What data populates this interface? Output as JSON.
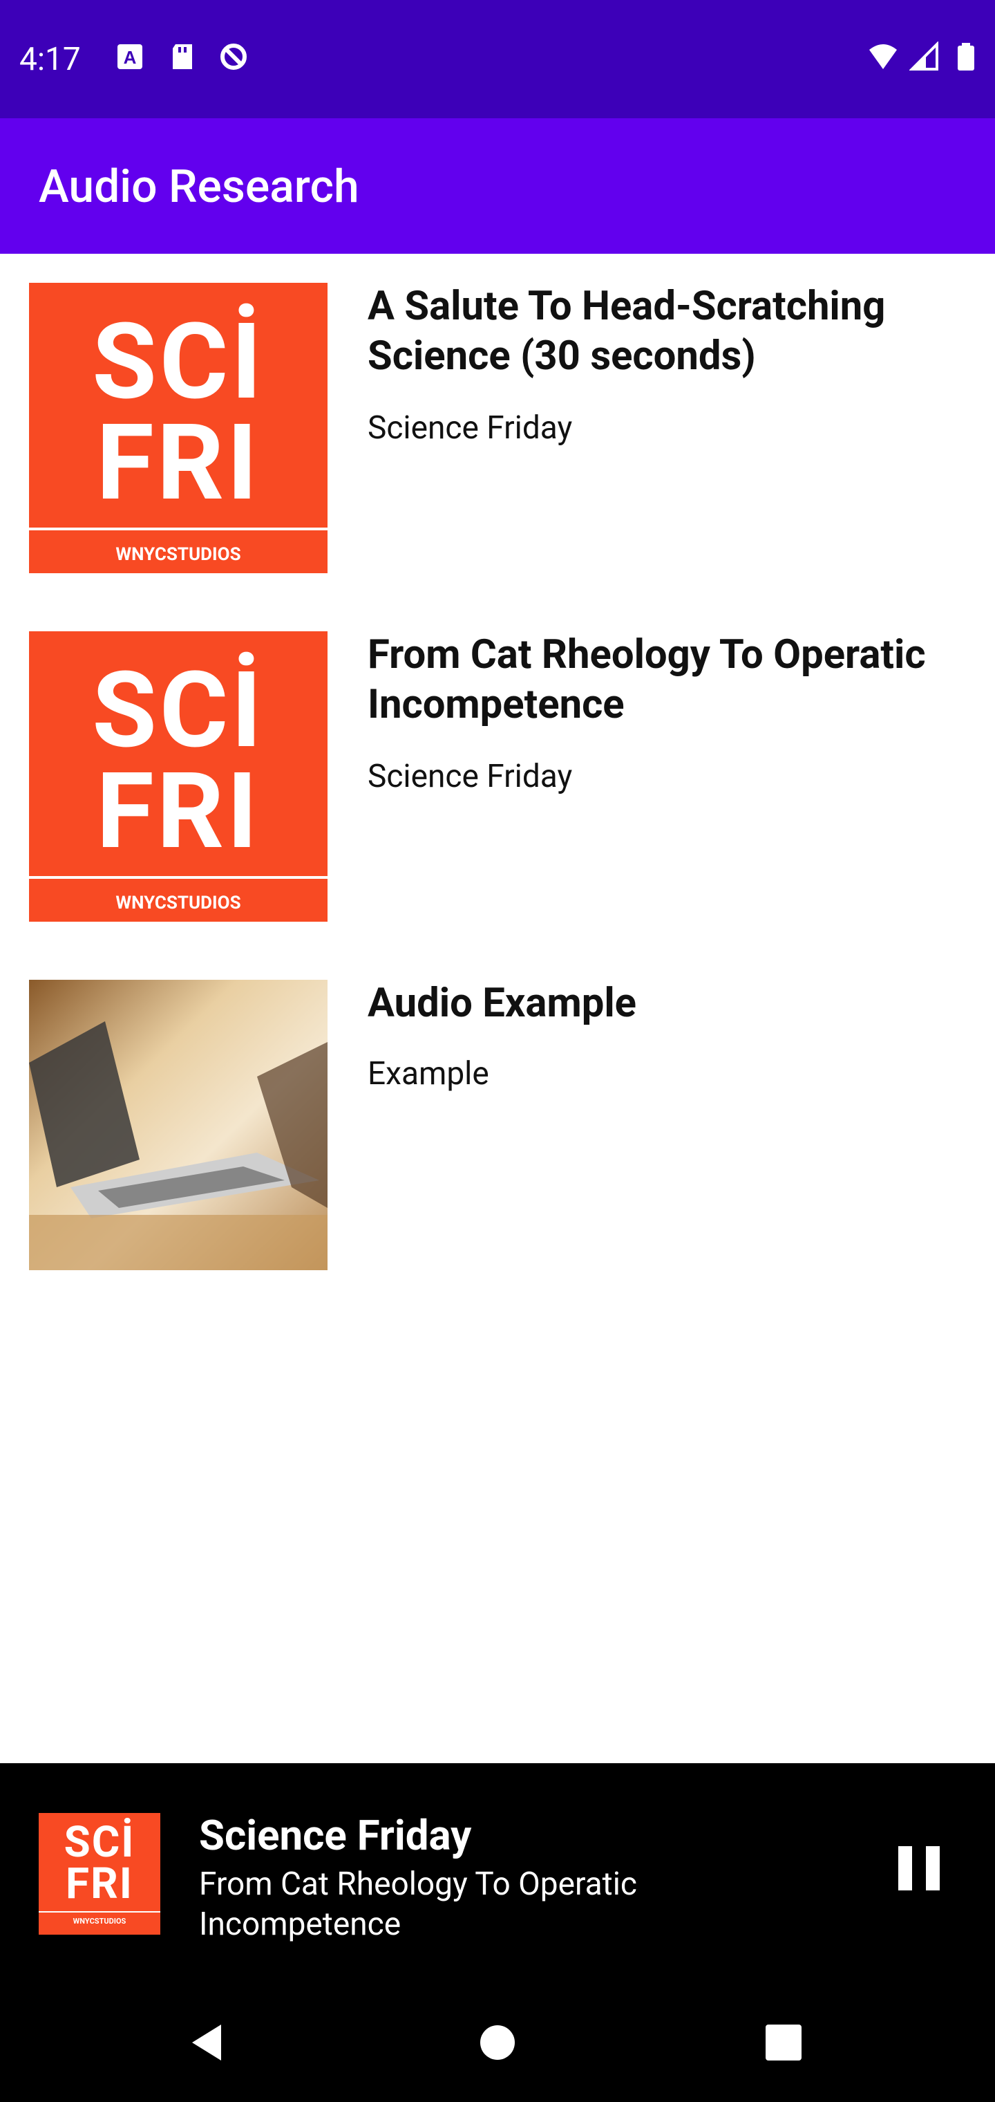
{
  "status": {
    "time": "4:17"
  },
  "app": {
    "title": "Audio Research"
  },
  "items": [
    {
      "title": "A Salute To Head-Scratching Science (30 seconds)",
      "subtitle": "Science Friday",
      "art": "scifri"
    },
    {
      "title": "From Cat Rheology To Operatic Incompetence",
      "subtitle": "Science Friday",
      "art": "scifri"
    },
    {
      "title": "Audio Example",
      "subtitle": "Example",
      "art": "laptop-photo"
    }
  ],
  "scifri_art": {
    "line1": "SCİ",
    "line2": "FRI",
    "studio": "WNYCSTUDIOS"
  },
  "player": {
    "title": "Science Friday",
    "subtitle": "From Cat Rheology To Operatic Incompetence",
    "state": "playing"
  },
  "colors": {
    "status_bar": "#3d00b8",
    "app_bar": "#6200ee",
    "scifri_orange": "#f84a23"
  }
}
